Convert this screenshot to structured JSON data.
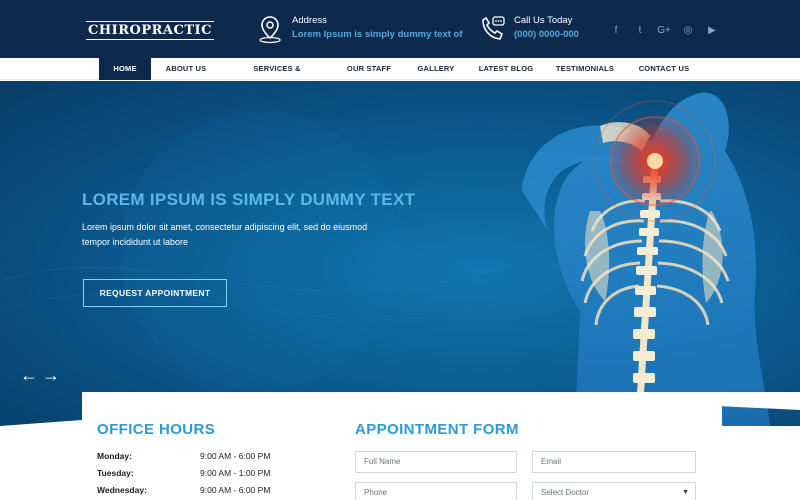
{
  "header": {
    "logo_text": "CHIROPRACTIC",
    "address": {
      "label": "Address",
      "value": "Lorem Ipsum is simply dummy text of"
    },
    "phone": {
      "label": "Call Us Today",
      "value": "(000) 0000-000"
    },
    "socials": [
      {
        "name": "facebook-icon",
        "glyph": "f"
      },
      {
        "name": "twitter-icon",
        "glyph": "t"
      },
      {
        "name": "google-plus-icon",
        "glyph": "G+"
      },
      {
        "name": "instagram-icon",
        "glyph": "◎"
      },
      {
        "name": "youtube-icon",
        "glyph": "▶"
      }
    ]
  },
  "nav": {
    "items": [
      {
        "label": "HOME",
        "active": true
      },
      {
        "label": "ABOUT US"
      },
      {
        "label": "SERVICES & TECHNIQUES"
      },
      {
        "label": "OUR STAFF"
      },
      {
        "label": "GALLERY"
      },
      {
        "label": "LATEST BLOG"
      },
      {
        "label": "TESTIMONIALS"
      },
      {
        "label": "CONTACT US"
      }
    ]
  },
  "hero": {
    "title": "LOREM IPSUM IS SIMPLY DUMMY TEXT",
    "text": "Lorem ipsum dolor sit amet, consectetur adipiscing elit, sed do eiusmod tempor incididunt ut labore",
    "button": "REQUEST APPOINTMENT",
    "prev": "←",
    "next": "→"
  },
  "office_hours": {
    "title": "OFFICE HOURS",
    "rows": [
      {
        "day": "Monday:",
        "time": "9:00 AM - 6:00 PM"
      },
      {
        "day": "Tuesday:",
        "time": "9:00 AM - 1:00 PM"
      },
      {
        "day": "Wednesday:",
        "time": "9:00 AM - 6:00 PM"
      }
    ]
  },
  "appointment": {
    "title": "APPOINTMENT FORM",
    "full_name": "Full Name",
    "email": "Email",
    "phone": "Phone",
    "doctor": "Select Doctor",
    "caret": "▼"
  },
  "colors": {
    "header_bg": "#0d2a4d",
    "accent": "#2c9ad6",
    "hero_title": "#5bb8e8"
  }
}
